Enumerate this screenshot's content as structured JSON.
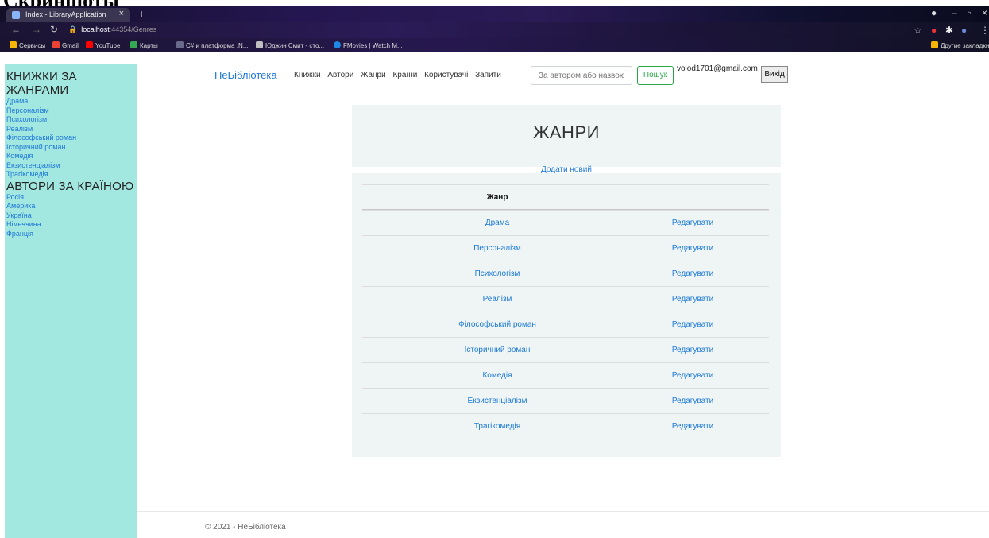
{
  "doc_heading": "Скриншоты",
  "browser": {
    "tab_title": "Index - LibraryApplication",
    "url_host": "localhost",
    "url_rest": ":44354/Genres",
    "bookmarks": [
      "Сервисы",
      "Gmail",
      "YouTube",
      "Карты",
      "C# и платформа .N...",
      "Юджин Смит - сто...",
      "FMovies | Watch M..."
    ],
    "other_bookmarks": "Другие закладки"
  },
  "sidebar": {
    "genres_heading": "КНИЖКИ ЗА ЖАНРАМИ",
    "genres": [
      "Драма",
      "Персоналізм",
      "Психологізм",
      "Реалізм",
      "Філософський роман",
      "Історичний роман",
      "Комедія",
      "Екзистенціалізм",
      "Трагікомедія"
    ],
    "authors_heading": "АВТОРИ ЗА КРАЇНОЮ",
    "countries": [
      "Росія",
      "Америка",
      "Україна",
      "Німеччина",
      "Франція"
    ]
  },
  "navbar": {
    "brand": "НеБібліотека",
    "links": [
      "Книжки",
      "Автори",
      "Жанри",
      "Країни",
      "Користувачі",
      "Запити"
    ],
    "search_placeholder": "За автором або назвою",
    "search_button": "Пошук",
    "user_email": "volod1701@gmail.com",
    "logout": "Вихід"
  },
  "main": {
    "title": "ЖАНРИ",
    "add_new": "Додати новий",
    "table_header": "Жанр",
    "edit_label": "Редагувати",
    "rows": [
      "Драма",
      "Персоналізм",
      "Психологізм",
      "Реалізм",
      "Філософський роман",
      "Історичний роман",
      "Комедія",
      "Екзистенціалізм",
      "Трагікомедія"
    ]
  },
  "footer": {
    "text": "© 2021 - НеБібліотека"
  }
}
